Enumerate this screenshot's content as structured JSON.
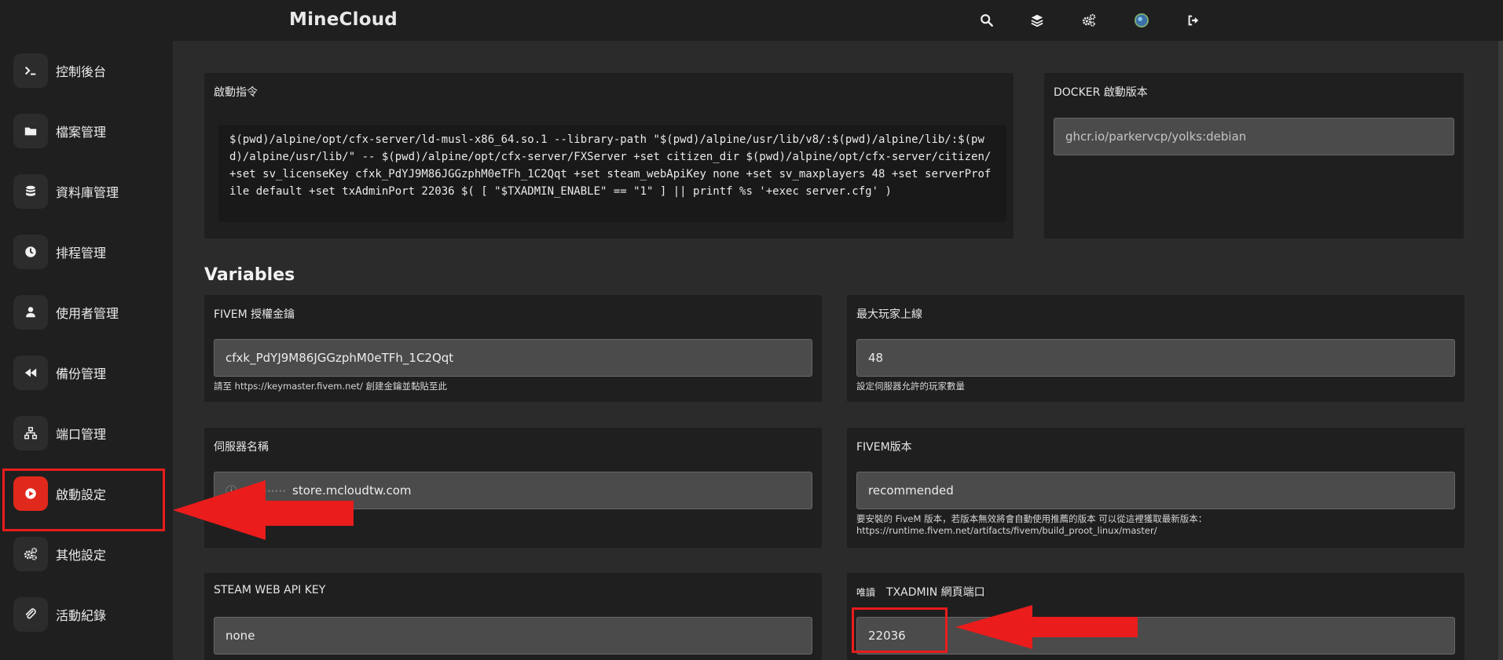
{
  "app": {
    "brand": "MineCloud"
  },
  "topbar": {
    "icons": [
      "search-icon",
      "layers-icon",
      "gears-icon",
      "avatar-icon",
      "logout-icon"
    ]
  },
  "sidebar": {
    "items": [
      {
        "label": "控制後台",
        "icon": "terminal-icon"
      },
      {
        "label": "檔案管理",
        "icon": "folder-icon"
      },
      {
        "label": "資料庫管理",
        "icon": "database-icon"
      },
      {
        "label": "排程管理",
        "icon": "clock-icon"
      },
      {
        "label": "使用者管理",
        "icon": "user-icon"
      },
      {
        "label": "備份管理",
        "icon": "rewind-icon"
      },
      {
        "label": "端口管理",
        "icon": "network-icon"
      },
      {
        "label": "啟動設定",
        "icon": "play-icon",
        "active": true
      },
      {
        "label": "其他設定",
        "icon": "gears-icon"
      },
      {
        "label": "活動紀錄",
        "icon": "paperclip-icon"
      }
    ]
  },
  "startup": {
    "title": "啟動指令",
    "command": "$(pwd)/alpine/opt/cfx-server/ld-musl-x86_64.so.1 --library-path \"$(pwd)/alpine/usr/lib/v8/:$(pwd)/alpine/lib/:$(pwd)/alpine/usr/lib/\" -- $(pwd)/alpine/opt/cfx-server/FXServer +set citizen_dir $(pwd)/alpine/opt/cfx-server/citizen/ +set sv_licenseKey cfxk_PdYJ9M86JGGzphM0eTFh_1C2Qqt +set steam_webApiKey none +set sv_maxplayers 48 +set serverProfile default +set txAdminPort 22036 $( [ \"$TXADMIN_ENABLE\" == \"1\" ] || printf %s '+exec server.cfg' )"
  },
  "docker": {
    "title": "DOCKER 啟動版本",
    "value": "ghcr.io/parkervcp/yolks:debian"
  },
  "variables": {
    "heading": "Variables",
    "license": {
      "title": "FIVEM 授權金鑰",
      "value": "cfxk_PdYJ9M86JGGzphM0eTFh_1C2Qqt",
      "hint": "請至 https://keymaster.fivem.net/ 創建金鑰並黏貼至此"
    },
    "maxplayers": {
      "title": "最大玩家上線",
      "value": "48",
      "hint": "設定伺服器允許的玩家數量"
    },
    "servername": {
      "title": "伺服器名稱",
      "value": "store.mcloudtw.com"
    },
    "version": {
      "title": "FIVEM版本",
      "value": "recommended",
      "hint_line1": "要安裝的 FiveM 版本，若版本無效將會自動使用推薦的版本 可以從這裡獲取最新版本：",
      "hint_line2": "https://runtime.fivem.net/artifacts/fivem/build_proot_linux/master/"
    },
    "steam": {
      "title": "STEAM WEB API KEY",
      "value": "none"
    },
    "txadmin": {
      "prefix": "唯讀",
      "title": "TXADMIN 網頁端口",
      "value": "22036"
    }
  },
  "colors": {
    "accent": "#e0281c",
    "annotation": "#ea1c1c"
  }
}
